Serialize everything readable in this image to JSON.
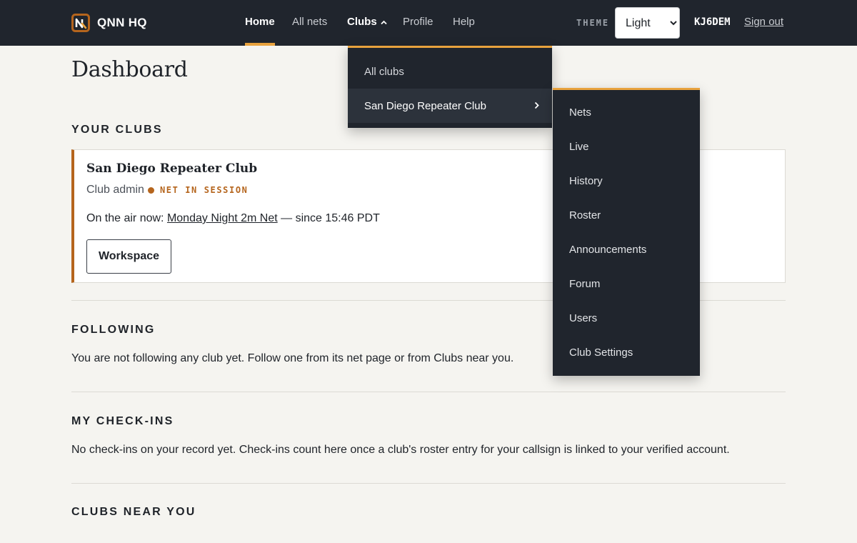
{
  "brand": {
    "name": "QNN HQ",
    "logo_icon": "qnn-logo-icon"
  },
  "nav": {
    "home": "Home",
    "all_nets": "All nets",
    "clubs": "Clubs",
    "profile": "Profile",
    "help": "Help"
  },
  "header": {
    "theme_label": "THEME",
    "theme_value": "Light",
    "theme_options": [
      "Light"
    ],
    "callsign": "KJ6DEM",
    "sign_out": "Sign out"
  },
  "page": {
    "title": "Dashboard"
  },
  "your_clubs": {
    "heading": "YOUR CLUBS",
    "card": {
      "club_name": "San Diego Repeater Club",
      "role": "Club admin",
      "status": "NET IN SESSION",
      "on_air_prefix": "On the air now:",
      "net_link": "Monday Night 2m Net",
      "on_air_suffix": "— since 15:46 PDT",
      "workspace_button": "Workspace"
    }
  },
  "following": {
    "heading": "FOLLOWING",
    "text": "You are not following any club yet. Follow one from its net page or from Clubs near you."
  },
  "checkins": {
    "heading": "MY CHECK-INS",
    "text": "No check-ins on your record yet. Check-ins count here once a club's roster entry for your callsign is linked to your verified account."
  },
  "nearby": {
    "heading": "CLUBS NEAR YOU"
  },
  "clubs_menu": {
    "items": [
      "All clubs",
      "San Diego Repeater Club"
    ],
    "submenu": [
      "Nets",
      "Live",
      "History",
      "Roster",
      "Announcements",
      "Forum",
      "Users",
      "Club Settings"
    ]
  },
  "colors": {
    "topbar": "#20252d",
    "accent": "#e8a23d",
    "status": "#b5651d",
    "page_bg": "#f5f4f0"
  }
}
